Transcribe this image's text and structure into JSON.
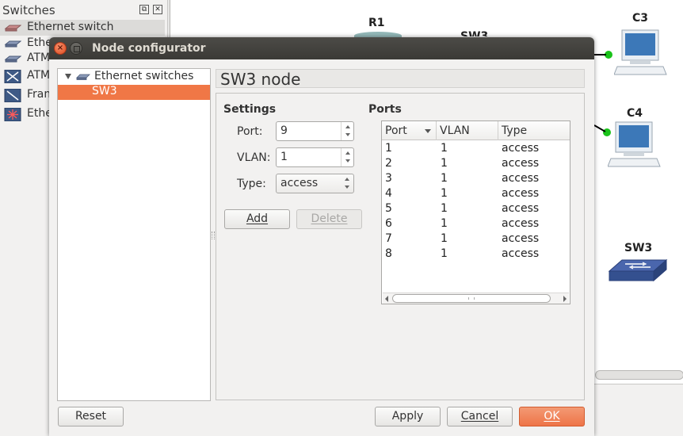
{
  "sidebar": {
    "title": "Switches",
    "items": [
      {
        "label": "Ethernet switch",
        "icon": "ethernet-switch-icon"
      },
      {
        "label": "Ethe",
        "icon": "ethernet-hub-icon"
      },
      {
        "label": "ATM",
        "icon": "atm-switch-icon"
      },
      {
        "label": "ATM",
        "icon": "atm-bridge-icon"
      },
      {
        "label": "Fram",
        "icon": "frame-relay-icon"
      },
      {
        "label": "Ethe",
        "icon": "ethernet-hub-red-icon"
      }
    ]
  },
  "canvas": {
    "nodes": [
      {
        "label": "R1"
      },
      {
        "label": "SW3"
      },
      {
        "label": "C3"
      },
      {
        "label": "C4"
      },
      {
        "label": "SW3"
      }
    ]
  },
  "dialog": {
    "title": "Node configurator",
    "tree": {
      "root_label": "Ethernet switches",
      "child_label": "SW3"
    },
    "node_title": "SW3 node",
    "settings": {
      "title": "Settings",
      "port_label": "Port:",
      "port_value": "9",
      "vlan_label": "VLAN:",
      "vlan_value": "1",
      "type_label": "Type:",
      "type_value": "access",
      "add_label": "Add",
      "delete_label": "Delete"
    },
    "ports": {
      "title": "Ports",
      "columns": [
        "Port",
        "VLAN",
        "Type"
      ],
      "rows": [
        {
          "port": "1",
          "vlan": "1",
          "type": "access"
        },
        {
          "port": "2",
          "vlan": "1",
          "type": "access"
        },
        {
          "port": "3",
          "vlan": "1",
          "type": "access"
        },
        {
          "port": "4",
          "vlan": "1",
          "type": "access"
        },
        {
          "port": "5",
          "vlan": "1",
          "type": "access"
        },
        {
          "port": "6",
          "vlan": "1",
          "type": "access"
        },
        {
          "port": "7",
          "vlan": "1",
          "type": "access"
        },
        {
          "port": "8",
          "vlan": "1",
          "type": "access"
        }
      ]
    },
    "buttons": {
      "reset": "Reset",
      "apply": "Apply",
      "cancel": "Cancel",
      "ok": "OK"
    }
  },
  "colors": {
    "accent": "#f07746",
    "titlebar": "#3c3b37",
    "link_dot": "#1ac21a"
  }
}
